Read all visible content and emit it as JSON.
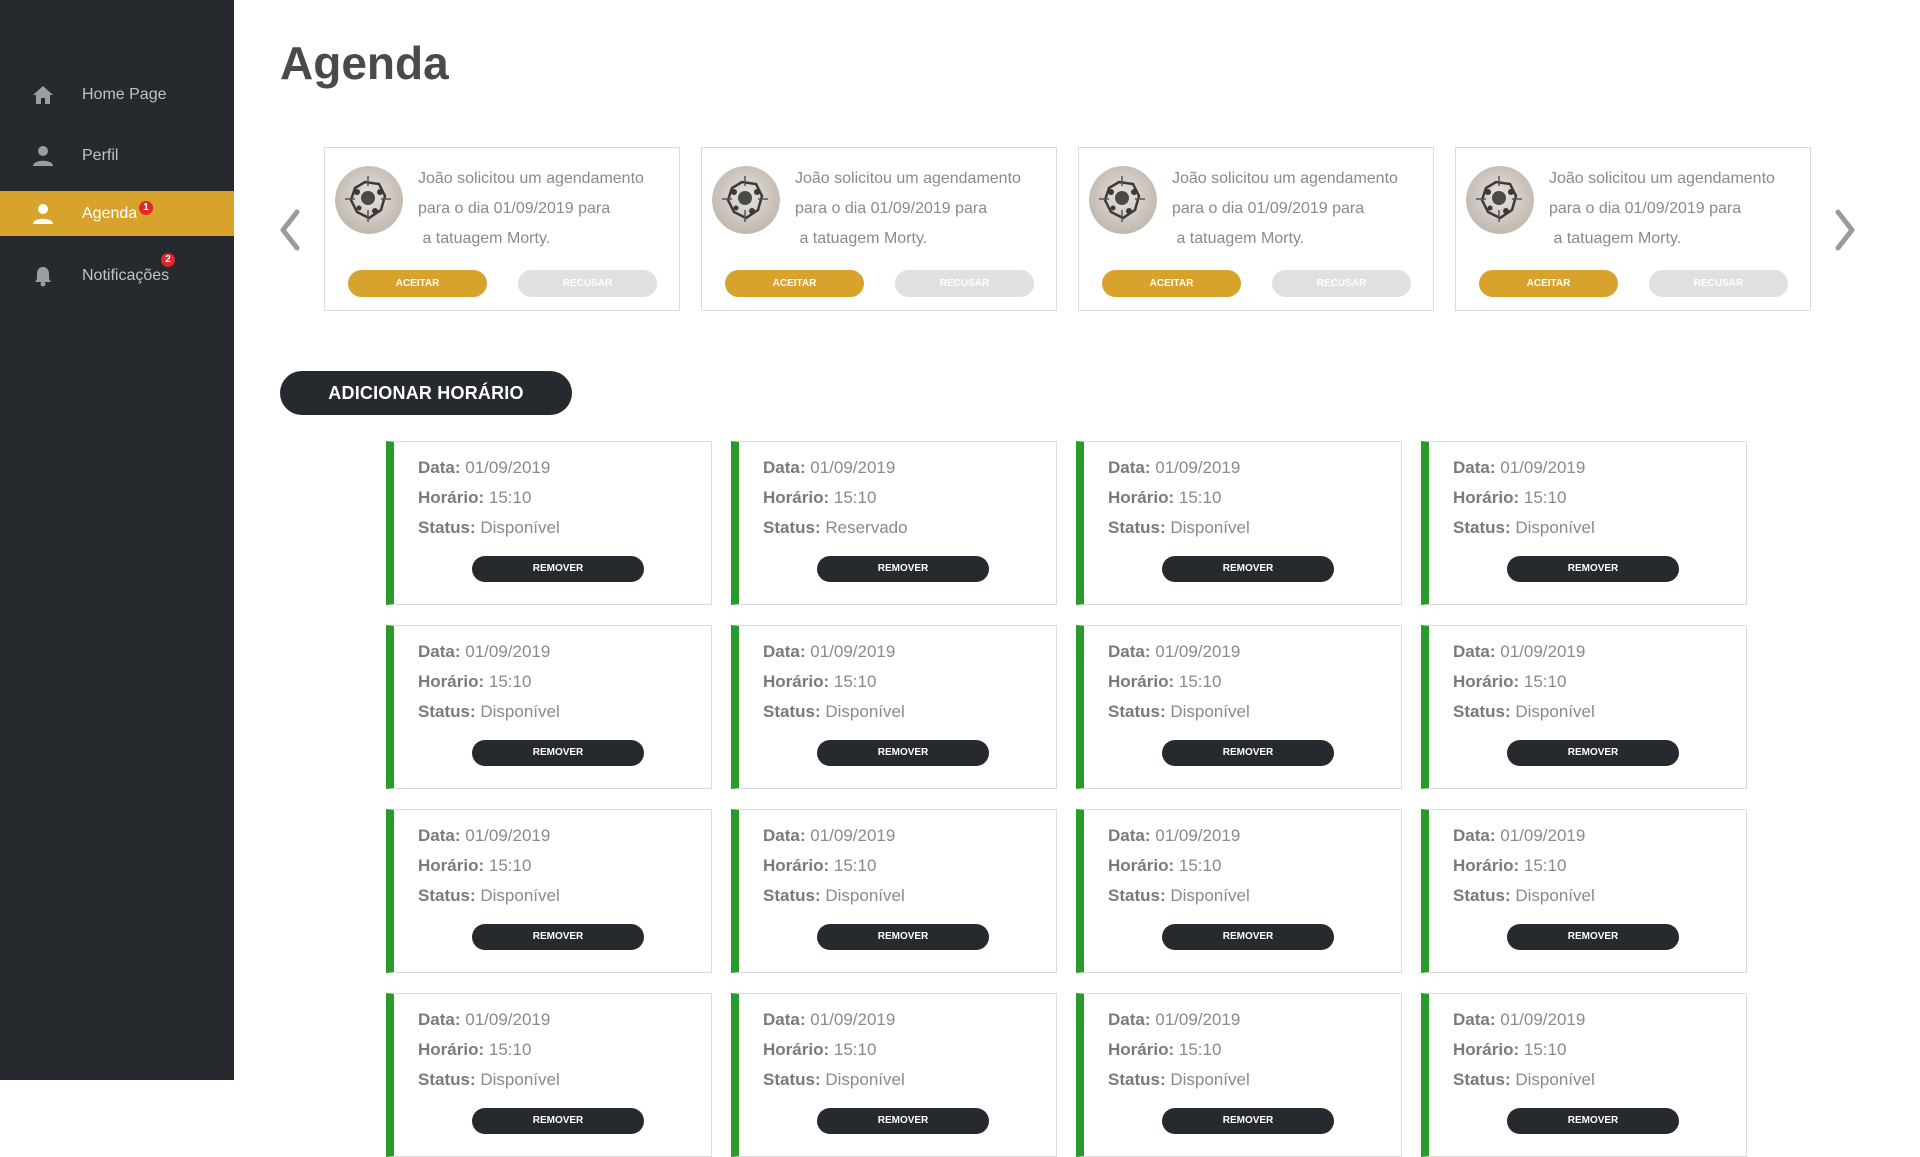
{
  "sidebar": {
    "items": [
      {
        "label": "Home Page",
        "icon": "home-icon",
        "active": false,
        "badge": ""
      },
      {
        "label": "Perfil",
        "icon": "person-icon",
        "active": false,
        "badge": ""
      },
      {
        "label": "Agenda",
        "icon": "person-icon",
        "active": true,
        "badge": "1"
      },
      {
        "label": "Notificações",
        "icon": "bell-icon",
        "active": false,
        "badge": "2"
      }
    ]
  },
  "page": {
    "title": "Agenda"
  },
  "requests": [
    {
      "line1": "João solicitou um agendamento",
      "line2": "para o dia  01/09/2019 para",
      "line3": " a tatuagem Morty.",
      "accept": "ACEITAR",
      "refuse": "RECUSAR"
    },
    {
      "line1": "João solicitou um agendamento",
      "line2": "para o dia  01/09/2019 para",
      "line3": " a tatuagem Morty.",
      "accept": "ACEITAR",
      "refuse": "RECUSAR"
    },
    {
      "line1": "João solicitou um agendamento",
      "line2": "para o dia  01/09/2019 para",
      "line3": " a tatuagem Morty.",
      "accept": "ACEITAR",
      "refuse": "RECUSAR"
    },
    {
      "line1": "João solicitou um agendamento",
      "line2": "para o dia  01/09/2019 para",
      "line3": " a tatuagem Morty.",
      "accept": "ACEITAR",
      "refuse": "RECUSAR"
    }
  ],
  "add_button": "ADICIONAR HORÁRIO",
  "slot_labels": {
    "date": "Data:",
    "time": "Horário:",
    "status": "Status:",
    "remove": "REMOVER"
  },
  "slots": [
    {
      "date": "01/09/2019",
      "time": "15:10",
      "status": "Disponível"
    },
    {
      "date": "01/09/2019",
      "time": "15:10",
      "status": "Reservado"
    },
    {
      "date": "01/09/2019",
      "time": "15:10",
      "status": "Disponível"
    },
    {
      "date": "01/09/2019",
      "time": "15:10",
      "status": "Disponível"
    },
    {
      "date": "01/09/2019",
      "time": "15:10",
      "status": "Disponível"
    },
    {
      "date": "01/09/2019",
      "time": "15:10",
      "status": "Disponível"
    },
    {
      "date": "01/09/2019",
      "time": "15:10",
      "status": "Disponível"
    },
    {
      "date": "01/09/2019",
      "time": "15:10",
      "status": "Disponível"
    },
    {
      "date": "01/09/2019",
      "time": "15:10",
      "status": "Disponível"
    },
    {
      "date": "01/09/2019",
      "time": "15:10",
      "status": "Disponível"
    },
    {
      "date": "01/09/2019",
      "time": "15:10",
      "status": "Disponível"
    },
    {
      "date": "01/09/2019",
      "time": "15:10",
      "status": "Disponível"
    },
    {
      "date": "01/09/2019",
      "time": "15:10",
      "status": "Disponível"
    },
    {
      "date": "01/09/2019",
      "time": "15:10",
      "status": "Disponível"
    },
    {
      "date": "01/09/2019",
      "time": "15:10",
      "status": "Disponível"
    },
    {
      "date": "01/09/2019",
      "time": "15:10",
      "status": "Disponível"
    }
  ],
  "colors": {
    "sidebar": "#262a2f",
    "accent": "#d7a32c",
    "slot_border": "#2a9a2a",
    "badge": "#e3262a"
  }
}
